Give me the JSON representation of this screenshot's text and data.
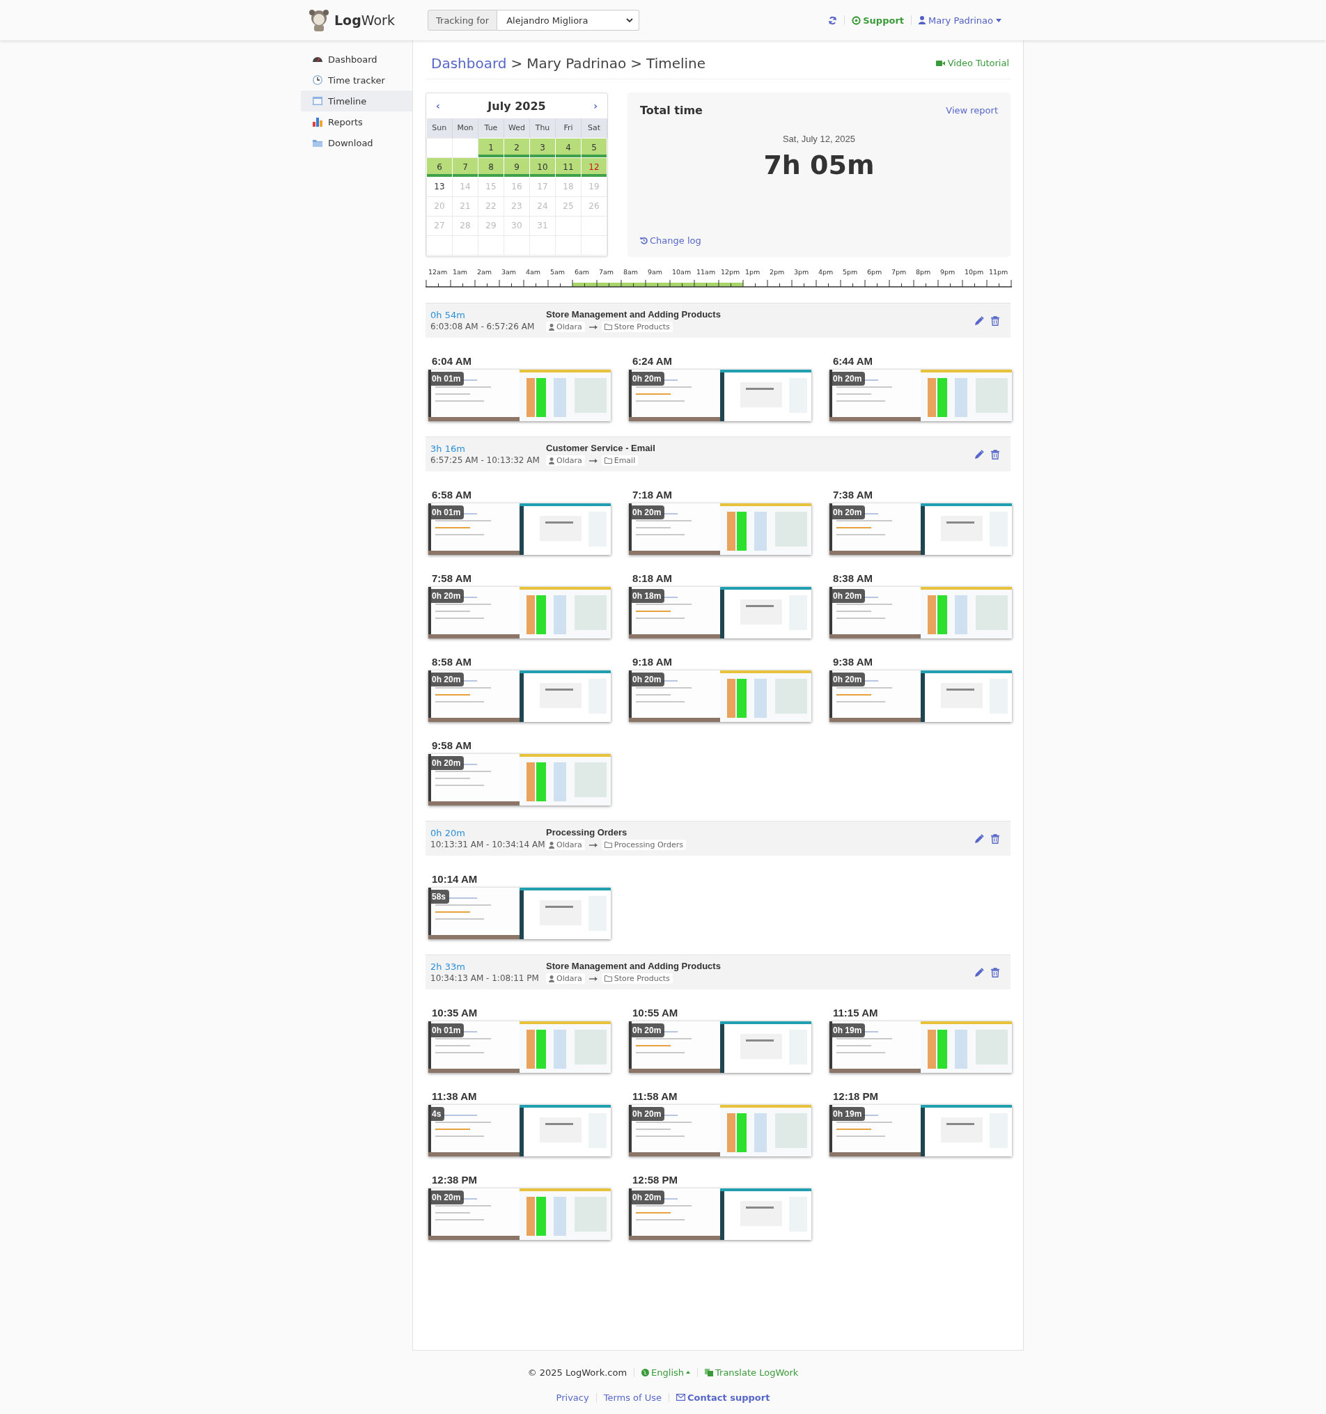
{
  "header": {
    "brand_bold": "Log",
    "brand_rest": "Work",
    "tracking_label": "Tracking for",
    "tracking_value": "Alejandro Migliora",
    "support": "Support",
    "user": "Mary Padrinao"
  },
  "sidebar": {
    "items": [
      {
        "label": "Dashboard",
        "selected": false
      },
      {
        "label": "Time tracker",
        "selected": false
      },
      {
        "label": "Timeline",
        "selected": true
      },
      {
        "label": "Reports",
        "selected": false
      },
      {
        "label": "Download",
        "selected": false
      }
    ]
  },
  "breadcrumb": {
    "items": [
      "Dashboard",
      "Mary Padrinao",
      "Timeline"
    ],
    "separator": ">"
  },
  "video_tutorial": "Video Tutorial",
  "calendar": {
    "prev": "‹",
    "title": "July 2025",
    "next": "›",
    "weekdays": [
      "Sun",
      "Mon",
      "Tue",
      "Wed",
      "Thu",
      "Fri",
      "Sat"
    ],
    "weeks": [
      [
        {
          "kind": "empty"
        },
        {
          "kind": "empty"
        },
        {
          "day": "1",
          "tracked": true,
          "selected": false,
          "future": false
        },
        {
          "day": "2",
          "tracked": true,
          "selected": false,
          "future": false
        },
        {
          "day": "3",
          "tracked": true,
          "selected": false,
          "future": false
        },
        {
          "day": "4",
          "tracked": true,
          "selected": false,
          "future": false
        },
        {
          "day": "5",
          "tracked": true,
          "selected": false,
          "future": false
        }
      ],
      [
        {
          "day": "6",
          "tracked": true,
          "selected": false,
          "future": false
        },
        {
          "day": "7",
          "tracked": true,
          "selected": false,
          "future": false
        },
        {
          "day": "8",
          "tracked": true,
          "selected": false,
          "future": false
        },
        {
          "day": "9",
          "tracked": true,
          "selected": false,
          "future": false
        },
        {
          "day": "10",
          "tracked": true,
          "selected": false,
          "future": false
        },
        {
          "day": "11",
          "tracked": true,
          "selected": false,
          "future": false
        },
        {
          "day": "12",
          "tracked": true,
          "selected": true,
          "future": false
        }
      ],
      [
        {
          "day": "13",
          "tracked": false,
          "selected": false,
          "future": false
        },
        {
          "day": "14",
          "tracked": false,
          "selected": false,
          "future": true
        },
        {
          "day": "15",
          "tracked": false,
          "selected": false,
          "future": true
        },
        {
          "day": "16",
          "tracked": false,
          "selected": false,
          "future": true
        },
        {
          "day": "17",
          "tracked": false,
          "selected": false,
          "future": true
        },
        {
          "day": "18",
          "tracked": false,
          "selected": false,
          "future": true
        },
        {
          "day": "19",
          "tracked": false,
          "selected": false,
          "future": true
        }
      ],
      [
        {
          "day": "20",
          "tracked": false,
          "selected": false,
          "future": true
        },
        {
          "day": "21",
          "tracked": false,
          "selected": false,
          "future": true
        },
        {
          "day": "22",
          "tracked": false,
          "selected": false,
          "future": true
        },
        {
          "day": "23",
          "tracked": false,
          "selected": false,
          "future": true
        },
        {
          "day": "24",
          "tracked": false,
          "selected": false,
          "future": true
        },
        {
          "day": "25",
          "tracked": false,
          "selected": false,
          "future": true
        },
        {
          "day": "26",
          "tracked": false,
          "selected": false,
          "future": true
        }
      ],
      [
        {
          "day": "27",
          "tracked": false,
          "selected": false,
          "future": true
        },
        {
          "day": "28",
          "tracked": false,
          "selected": false,
          "future": true
        },
        {
          "day": "29",
          "tracked": false,
          "selected": false,
          "future": true
        },
        {
          "day": "30",
          "tracked": false,
          "selected": false,
          "future": true
        },
        {
          "day": "31",
          "tracked": false,
          "selected": false,
          "future": true
        },
        {
          "kind": "empty"
        },
        {
          "kind": "empty"
        }
      ]
    ]
  },
  "total": {
    "title": "Total time",
    "view_report": "View report",
    "date": "Sat, July 12, 2025",
    "value": "7h 05m",
    "change_log": "Change log"
  },
  "axis": {
    "hours": [
      {
        "label": "12am",
        "active": false
      },
      {
        "label": "1am",
        "active": false
      },
      {
        "label": "2am",
        "active": false
      },
      {
        "label": "3am",
        "active": false
      },
      {
        "label": "4am",
        "active": false
      },
      {
        "label": "5am",
        "active": false
      },
      {
        "label": "6am",
        "active": true
      },
      {
        "label": "7am",
        "active": true
      },
      {
        "label": "8am",
        "active": true
      },
      {
        "label": "9am",
        "active": true
      },
      {
        "label": "10am",
        "active": true
      },
      {
        "label": "11am",
        "active": true
      },
      {
        "label": "12pm",
        "active": true
      },
      {
        "label": "1pm",
        "active": false
      },
      {
        "label": "2pm",
        "active": false
      },
      {
        "label": "3pm",
        "active": false
      },
      {
        "label": "4pm",
        "active": false
      },
      {
        "label": "5pm",
        "active": false
      },
      {
        "label": "6pm",
        "active": false
      },
      {
        "label": "7pm",
        "active": false
      },
      {
        "label": "8pm",
        "active": false
      },
      {
        "label": "9pm",
        "active": false
      },
      {
        "label": "10pm",
        "active": false
      },
      {
        "label": "11pm",
        "active": false
      }
    ]
  },
  "entries": [
    {
      "duration": "0h 54m",
      "range": "6:03:08 AM - 6:57:26 AM",
      "title": "Store Management and Adding Products",
      "client": "Oldara",
      "project": "Store Products",
      "shots": [
        {
          "time": "6:04 AM",
          "duration": "0h 01m"
        },
        {
          "time": "6:24 AM",
          "duration": "0h 20m"
        },
        {
          "time": "6:44 AM",
          "duration": "0h 20m"
        }
      ]
    },
    {
      "duration": "3h 16m",
      "range": "6:57:25 AM - 10:13:32 AM",
      "title": "Customer Service - Email",
      "client": "Oldara",
      "project": "Email",
      "shots": [
        {
          "time": "6:58 AM",
          "duration": "0h 01m"
        },
        {
          "time": "7:18 AM",
          "duration": "0h 20m"
        },
        {
          "time": "7:38 AM",
          "duration": "0h 20m"
        },
        {
          "time": "7:58 AM",
          "duration": "0h 20m"
        },
        {
          "time": "8:18 AM",
          "duration": "0h 18m"
        },
        {
          "time": "8:38 AM",
          "duration": "0h 20m"
        },
        {
          "time": "8:58 AM",
          "duration": "0h 20m"
        },
        {
          "time": "9:18 AM",
          "duration": "0h 20m"
        },
        {
          "time": "9:38 AM",
          "duration": "0h 20m"
        },
        {
          "time": "9:58 AM",
          "duration": "0h 20m"
        }
      ]
    },
    {
      "duration": "0h 20m",
      "range": "10:13:31 AM - 10:34:14 AM",
      "title": "Processing Orders",
      "client": "Oldara",
      "project": "Processing Orders",
      "shots": [
        {
          "time": "10:14 AM",
          "duration": "58s"
        }
      ]
    },
    {
      "duration": "2h 33m",
      "range": "10:34:13 AM - 1:08:11 PM",
      "title": "Store Management and Adding Products",
      "client": "Oldara",
      "project": "Store Products",
      "shots": [
        {
          "time": "10:35 AM",
          "duration": "0h 01m"
        },
        {
          "time": "10:55 AM",
          "duration": "0h 20m"
        },
        {
          "time": "11:15 AM",
          "duration": "0h 19m"
        },
        {
          "time": "11:38 AM",
          "duration": "4s"
        },
        {
          "time": "11:58 AM",
          "duration": "0h 20m"
        },
        {
          "time": "12:18 PM",
          "duration": "0h 19m"
        },
        {
          "time": "12:38 PM",
          "duration": "0h 20m"
        },
        {
          "time": "12:58 PM",
          "duration": "0h 20m"
        }
      ]
    }
  ],
  "footer": {
    "copyright": "© 2025 LogWork.com",
    "language": "English",
    "translate": "Translate LogWork",
    "links": [
      "Privacy",
      "Terms of Use"
    ],
    "contact": "Contact support"
  }
}
